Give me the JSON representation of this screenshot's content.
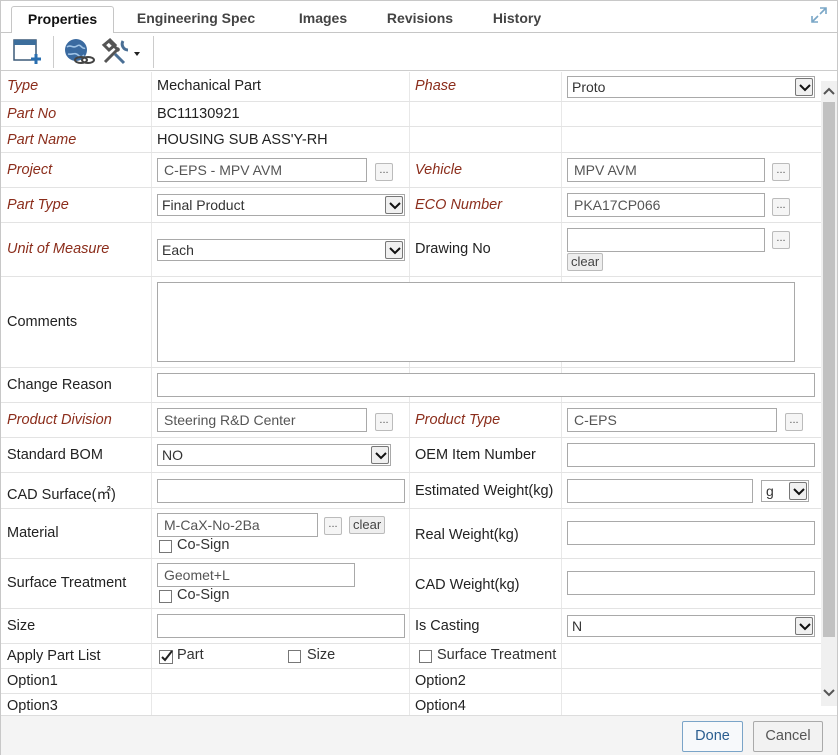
{
  "tabs": {
    "properties": "Properties",
    "engineering_spec": "Engineering Spec",
    "images": "Images",
    "revisions": "Revisions",
    "history": "History"
  },
  "form": {
    "type_label": "Type",
    "type_value": "Mechanical Part",
    "phase_label": "Phase",
    "phase_value": "Proto",
    "part_no_label": "Part No",
    "part_no_value": "BC11130921",
    "part_name_label": "Part Name",
    "part_name_value": "HOUSING SUB ASS'Y-RH",
    "project_label": "Project",
    "project_value": "C-EPS - MPV AVM",
    "vehicle_label": "Vehicle",
    "vehicle_value": "MPV AVM",
    "part_type_label": "Part Type",
    "part_type_value": "Final Product",
    "eco_label": "ECO Number",
    "eco_value": "PKA17CP066",
    "uom_label": "Unit of Measure",
    "uom_value": "Each",
    "drawing_no_label": "Drawing No",
    "drawing_no_value": "",
    "clear_label": "clear",
    "comments_label": "Comments",
    "comments_value": "",
    "change_reason_label": "Change Reason",
    "change_reason_value": "",
    "product_division_label": "Product Division",
    "product_division_value": "Steering R&D Center",
    "product_type_label": "Product Type",
    "product_type_value": "C-EPS",
    "standard_bom_label": "Standard BOM",
    "standard_bom_value": "NO",
    "oem_label": "OEM Item Number",
    "oem_value": "",
    "cad_surface_label": "CAD Surface(㎡)",
    "cad_surface_value": "",
    "est_weight_label": "Estimated Weight(kg)",
    "est_weight_value": "",
    "est_weight_unit": "g",
    "material_label": "Material",
    "material_value": "M-CaX-No-2Ba",
    "cosign_label": "Co-Sign",
    "real_weight_label": "Real Weight(kg)",
    "real_weight_value": "",
    "surface_treatment_label": "Surface Treatment",
    "surface_treatment_value": "Geomet+L",
    "cad_weight_label": "CAD Weight(kg)",
    "cad_weight_value": "",
    "size_label": "Size",
    "size_value": "",
    "is_casting_label": "Is Casting",
    "is_casting_value": "N",
    "apply_part_list_label": "Apply Part List",
    "apl_part": "Part",
    "apl_size": "Size",
    "apl_surface": "Surface Treatment",
    "option1_label": "Option1",
    "option2_label": "Option2",
    "option3_label": "Option3",
    "option4_label": "Option4",
    "dots": "..."
  },
  "footer": {
    "done": "Done",
    "cancel": "Cancel"
  }
}
